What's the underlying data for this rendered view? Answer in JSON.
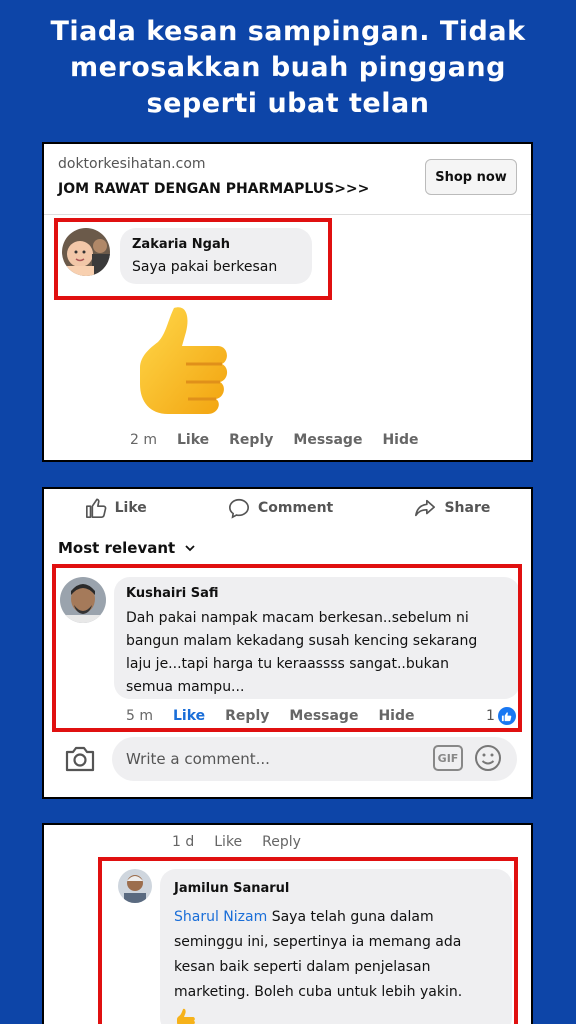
{
  "headline": {
    "line1": "Tiada kesan sampingan. Tidak",
    "line2": "merosakkan buah pinggang",
    "line3": "seperti ubat telan"
  },
  "card1": {
    "ad_source": "doktorkesihatan.com",
    "ad_title": "JOM RAWAT DENGAN PHARMAPLUS>>>",
    "shop_label": "Shop now",
    "comment": {
      "name": "Zakaria Ngah",
      "text": "Saya pakai berkesan",
      "sticker": "thumbs-up"
    },
    "actions": {
      "time": "2 m",
      "like": "Like",
      "reply": "Reply",
      "message": "Message",
      "hide": "Hide"
    }
  },
  "card2": {
    "reactions": {
      "like": "Like",
      "comment": "Comment",
      "share": "Share"
    },
    "sort_label": "Most relevant",
    "comment": {
      "name": "Kushairi Safi",
      "lines": [
        "Dah pakai nampak macam berkesan..sebelum ni",
        "bangun malam kekadang susah kencing sekarang",
        "laju je...tapi harga tu keraassss sangat..bukan",
        "semua mampu..."
      ]
    },
    "actions": {
      "time": "5 m",
      "like": "Like",
      "reply": "Reply",
      "message": "Message",
      "hide": "Hide",
      "like_count": "1"
    },
    "write_placeholder": "Write a comment...",
    "gif_label": "GIF"
  },
  "card3": {
    "top_actions": {
      "time": "1 d",
      "like": "Like",
      "reply": "Reply"
    },
    "comment": {
      "name": "Jamilun Sanarul",
      "mention": "Sharul Nizam",
      "line1": "Saya telah guna dalam",
      "lines": [
        "seminggu ini, sepertinya ia memang ada",
        "kesan baik seperti dalam penjelasan",
        "marketing. Boleh cuba untuk lebih yakin."
      ]
    }
  },
  "colors": {
    "background": "#0d45a8",
    "highlight": "#e01010",
    "fb_blue": "#1a6ed8"
  }
}
